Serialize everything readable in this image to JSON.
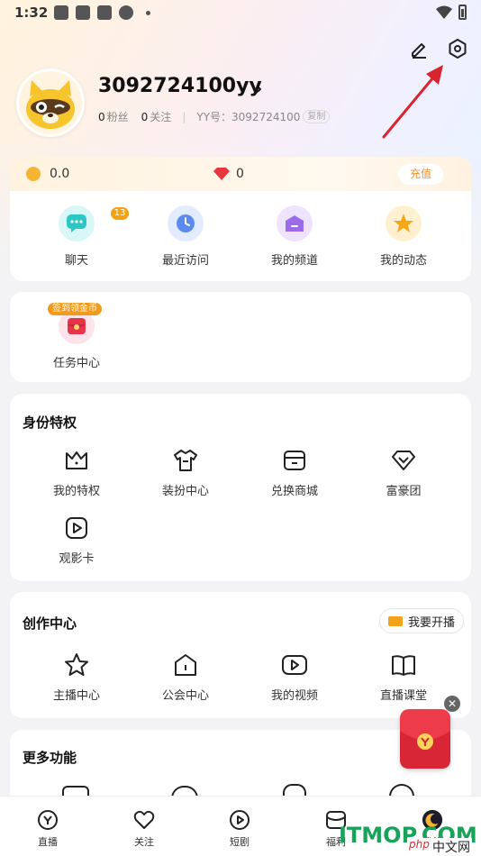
{
  "status_bar": {
    "time": "1:32"
  },
  "profile": {
    "username": "3092724100yy",
    "fans_count": "0",
    "fans_label": "粉丝",
    "follow_count": "0",
    "follow_label": "关注",
    "yy_label": "YY号：",
    "yy_number": "3092724100",
    "copy_label": "复制"
  },
  "wallet": {
    "coins": "0.0",
    "diamonds": "0",
    "recharge_label": "充值"
  },
  "quick_actions": [
    {
      "label": "聊天",
      "badge": "13",
      "icon": "chat-icon"
    },
    {
      "label": "最近访问",
      "icon": "clock-icon"
    },
    {
      "label": "我的频道",
      "icon": "channel-icon"
    },
    {
      "label": "我的动态",
      "icon": "star-icon"
    }
  ],
  "task_card": {
    "tag": "签到领金币",
    "label": "任务中心"
  },
  "identity": {
    "title": "身份特权",
    "items": [
      {
        "label": "我的特权",
        "icon": "crown-icon"
      },
      {
        "label": "装扮中心",
        "icon": "shirt-icon"
      },
      {
        "label": "兑换商城",
        "icon": "shop-icon"
      },
      {
        "label": "富豪团",
        "icon": "diamond-icon"
      },
      {
        "label": "观影卡",
        "icon": "movie-card-icon"
      }
    ]
  },
  "creation": {
    "title": "创作中心",
    "live_button": "我要开播",
    "items": [
      {
        "label": "主播中心",
        "icon": "star-outline-icon"
      },
      {
        "label": "公会中心",
        "icon": "guild-icon"
      },
      {
        "label": "我的视频",
        "icon": "video-icon"
      },
      {
        "label": "直播课堂",
        "icon": "book-icon"
      }
    ]
  },
  "more": {
    "title": "更多功能"
  },
  "tabs": [
    {
      "label": "直播",
      "icon": "live-tab-icon"
    },
    {
      "label": "关注",
      "icon": "heart-tab-icon"
    },
    {
      "label": "短剧",
      "icon": "play-tab-icon"
    },
    {
      "label": "福利",
      "icon": "gift-tab-icon"
    },
    {
      "label": "我的",
      "icon": "me-tab-icon"
    }
  ],
  "watermark": {
    "text": "ITMOP.COM",
    "sub": "中文网",
    "php": "php"
  },
  "colors": {
    "accent": "#f4a21a",
    "badge": "#f5a312",
    "arrow": "#d9232e"
  }
}
